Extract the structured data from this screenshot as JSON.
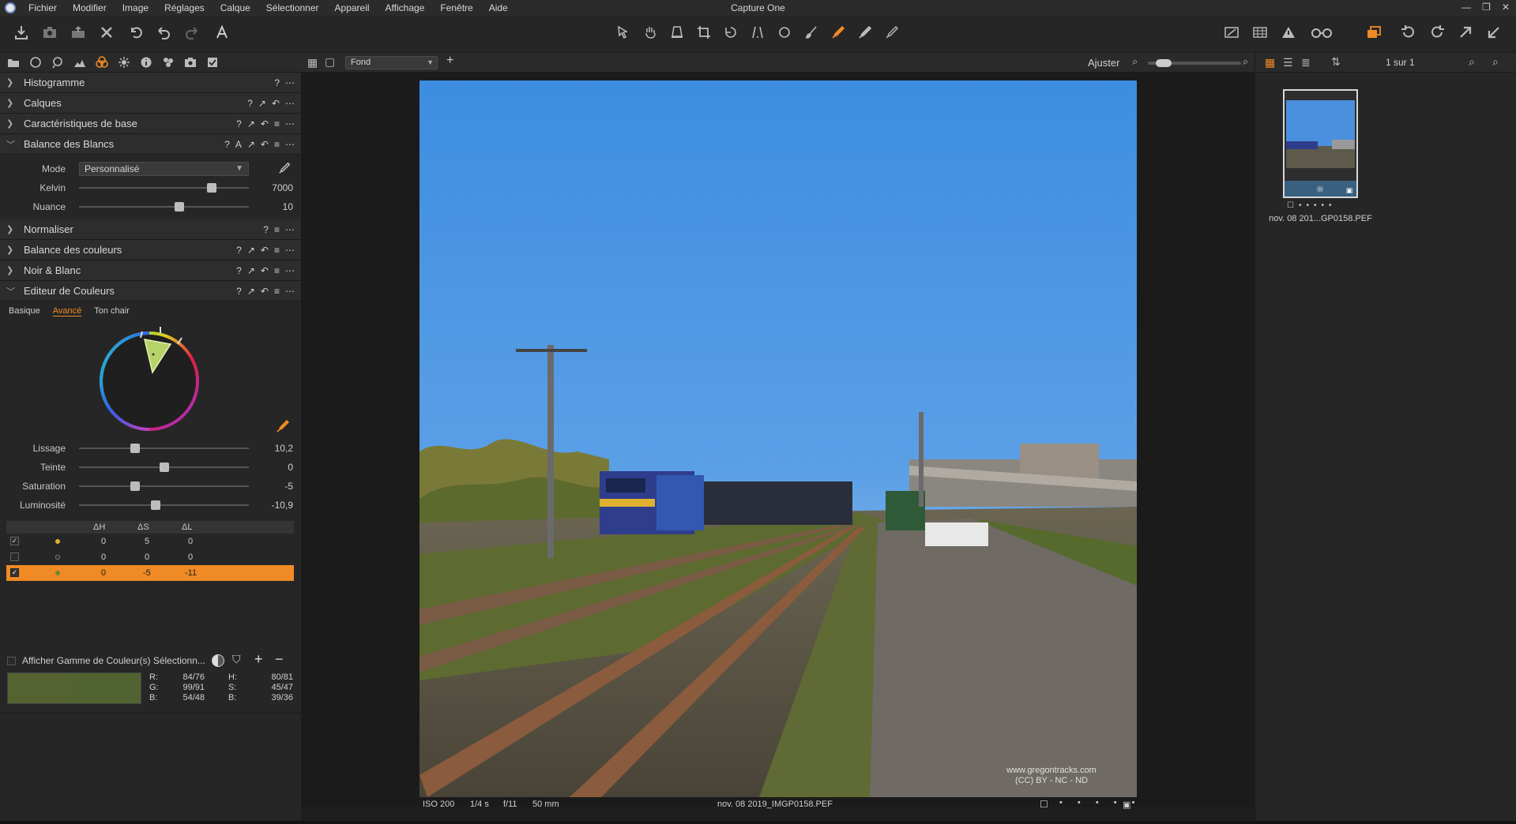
{
  "app": {
    "title": "Capture One",
    "menu": [
      "Fichier",
      "Modifier",
      "Image",
      "Réglages",
      "Calque",
      "Sélectionner",
      "Appareil",
      "Affichage",
      "Fenêtre",
      "Aide"
    ]
  },
  "colors": {
    "accent": "#f08a24",
    "panel_bg": "#262626",
    "header_bg": "#2d2d2d",
    "swatch_before": "#54632f",
    "swatch_after": "#506330"
  },
  "left_panel": {
    "sections_top": [
      {
        "label": "Histogramme",
        "expanded": false,
        "icons": [
          "?",
          "⋯"
        ]
      },
      {
        "label": "Calques",
        "expanded": false,
        "icons": [
          "?",
          "↗",
          "↶",
          "⋯"
        ]
      },
      {
        "label": "Caractéristiques de base",
        "expanded": false,
        "icons": [
          "?",
          "↗",
          "↶",
          "≡",
          "⋯"
        ]
      }
    ],
    "white_balance": {
      "label": "Balance des Blancs",
      "icons": [
        "?",
        "A",
        "↗",
        "↶",
        "≡",
        "⋯"
      ],
      "mode_label": "Mode",
      "mode_value": "Personnalisé",
      "kelvin_label": "Kelvin",
      "kelvin_value": "7000",
      "kelvin_pos": 0.78,
      "nuance_label": "Nuance",
      "nuance_value": "10",
      "nuance_pos": 0.59
    },
    "sections_mid": [
      {
        "label": "Normaliser",
        "expanded": false,
        "icons": [
          "?",
          "≡",
          "⋯"
        ]
      },
      {
        "label": "Balance des couleurs",
        "expanded": false,
        "icons": [
          "?",
          "↗",
          "↶",
          "≡",
          "⋯"
        ]
      },
      {
        "label": "Noir & Blanc",
        "expanded": false,
        "icons": [
          "?",
          "↗",
          "↶",
          "≡",
          "⋯"
        ]
      }
    ],
    "color_editor": {
      "label": "Editeur de Couleurs",
      "icons": [
        "?",
        "↗",
        "↶",
        "≡",
        "⋯"
      ],
      "tabs": [
        "Basique",
        "Avancé",
        "Ton chair"
      ],
      "active_tab": "Avancé",
      "sliders": [
        {
          "label": "Lissage",
          "value": "10,2",
          "pos": 0.33
        },
        {
          "label": "Teinte",
          "value": "0",
          "pos": 0.5
        },
        {
          "label": "Saturation",
          "value": "-5",
          "pos": 0.33
        },
        {
          "label": "Luminosité",
          "value": "-10,9",
          "pos": 0.45
        }
      ],
      "table_headers": [
        "ΔH",
        "ΔS",
        "ΔL"
      ],
      "rows": [
        {
          "checked": true,
          "dot": "#e0b030",
          "dh": "0",
          "ds": "5",
          "dl": "0",
          "selected": false
        },
        {
          "checked": false,
          "dot": "#777777",
          "dh": "0",
          "ds": "0",
          "dl": "0",
          "selected": false
        },
        {
          "checked": true,
          "dot": "#6a8a30",
          "dh": "0",
          "ds": "-5",
          "dl": "-11",
          "selected": true
        }
      ]
    },
    "gamut": {
      "label": "Afficher Gamme de Couleur(s) Sélectionn..."
    },
    "readout": {
      "r_label": "R:",
      "r_value": "84/76",
      "g_label": "G:",
      "g_value": "99/91",
      "b_label": "B:",
      "b_value": "54/48",
      "h_label": "H:",
      "h_value": "80/81",
      "s_label": "S:",
      "s_value": "45/47",
      "bb_label": "B:",
      "bb_value": "39/36"
    }
  },
  "viewer": {
    "layer_select": "Fond",
    "fit_label": "Ajuster",
    "zoom_level": 0.1,
    "watermark_line1": "www.gregontracks.com",
    "watermark_line2": "(CC) BY - NC - ND",
    "status": {
      "iso": "ISO 200",
      "shutter": "1/4 s",
      "aperture": "f/11",
      "focal": "50 mm",
      "filename": "nov. 08 2019_IMGP0158.PEF"
    }
  },
  "browser": {
    "count": "1 sur 1",
    "thumb_name": "nov. 08 201...GP0158.PEF"
  }
}
